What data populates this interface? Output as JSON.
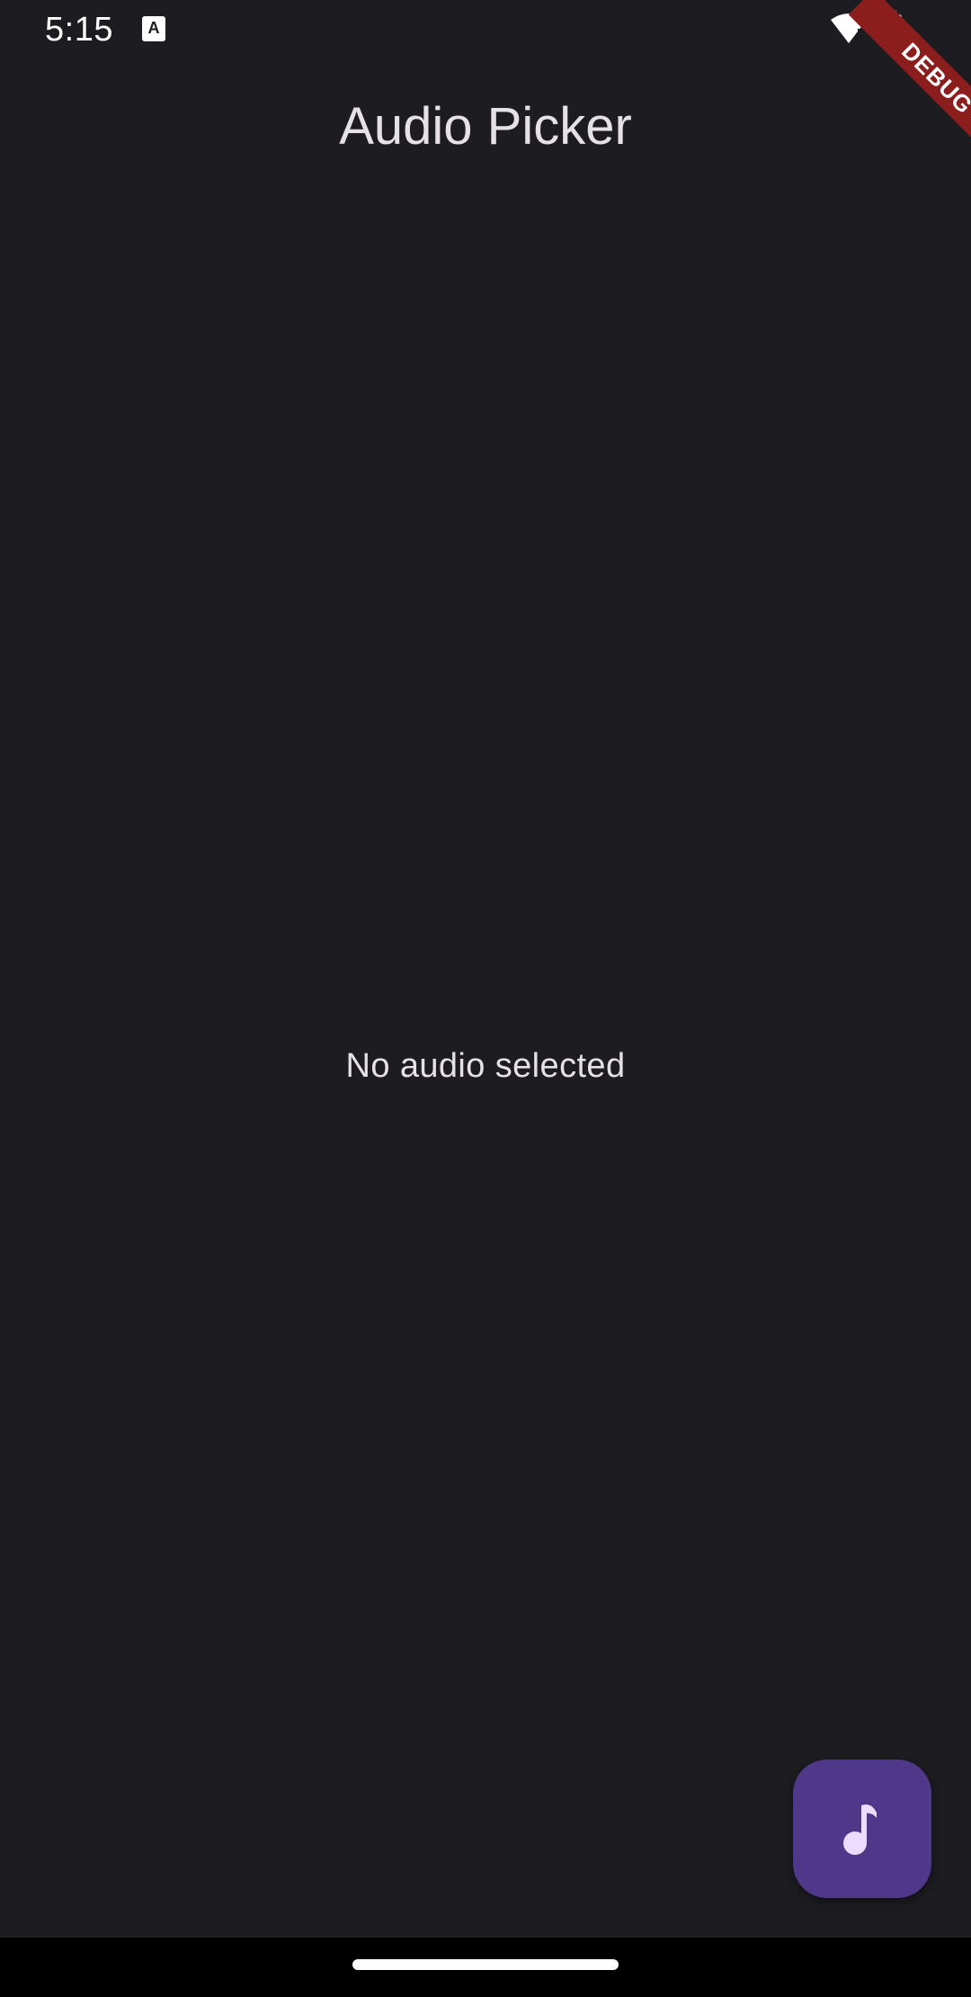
{
  "status_bar": {
    "time": "5:15",
    "notification_icon": "a-notification-icon",
    "wifi_icon": "wifi-alert-icon",
    "battery_icon": "battery-icon"
  },
  "debug_banner": "DEBUG",
  "app_bar": {
    "title": "Audio Picker"
  },
  "body": {
    "empty_message": "No audio selected"
  },
  "fab": {
    "icon": "music-note-icon",
    "color": "#4f378a"
  },
  "theme": {
    "background": "#1d1c21",
    "text": "#e6e1e6",
    "debug_ribbon": "#8b1d1d"
  }
}
